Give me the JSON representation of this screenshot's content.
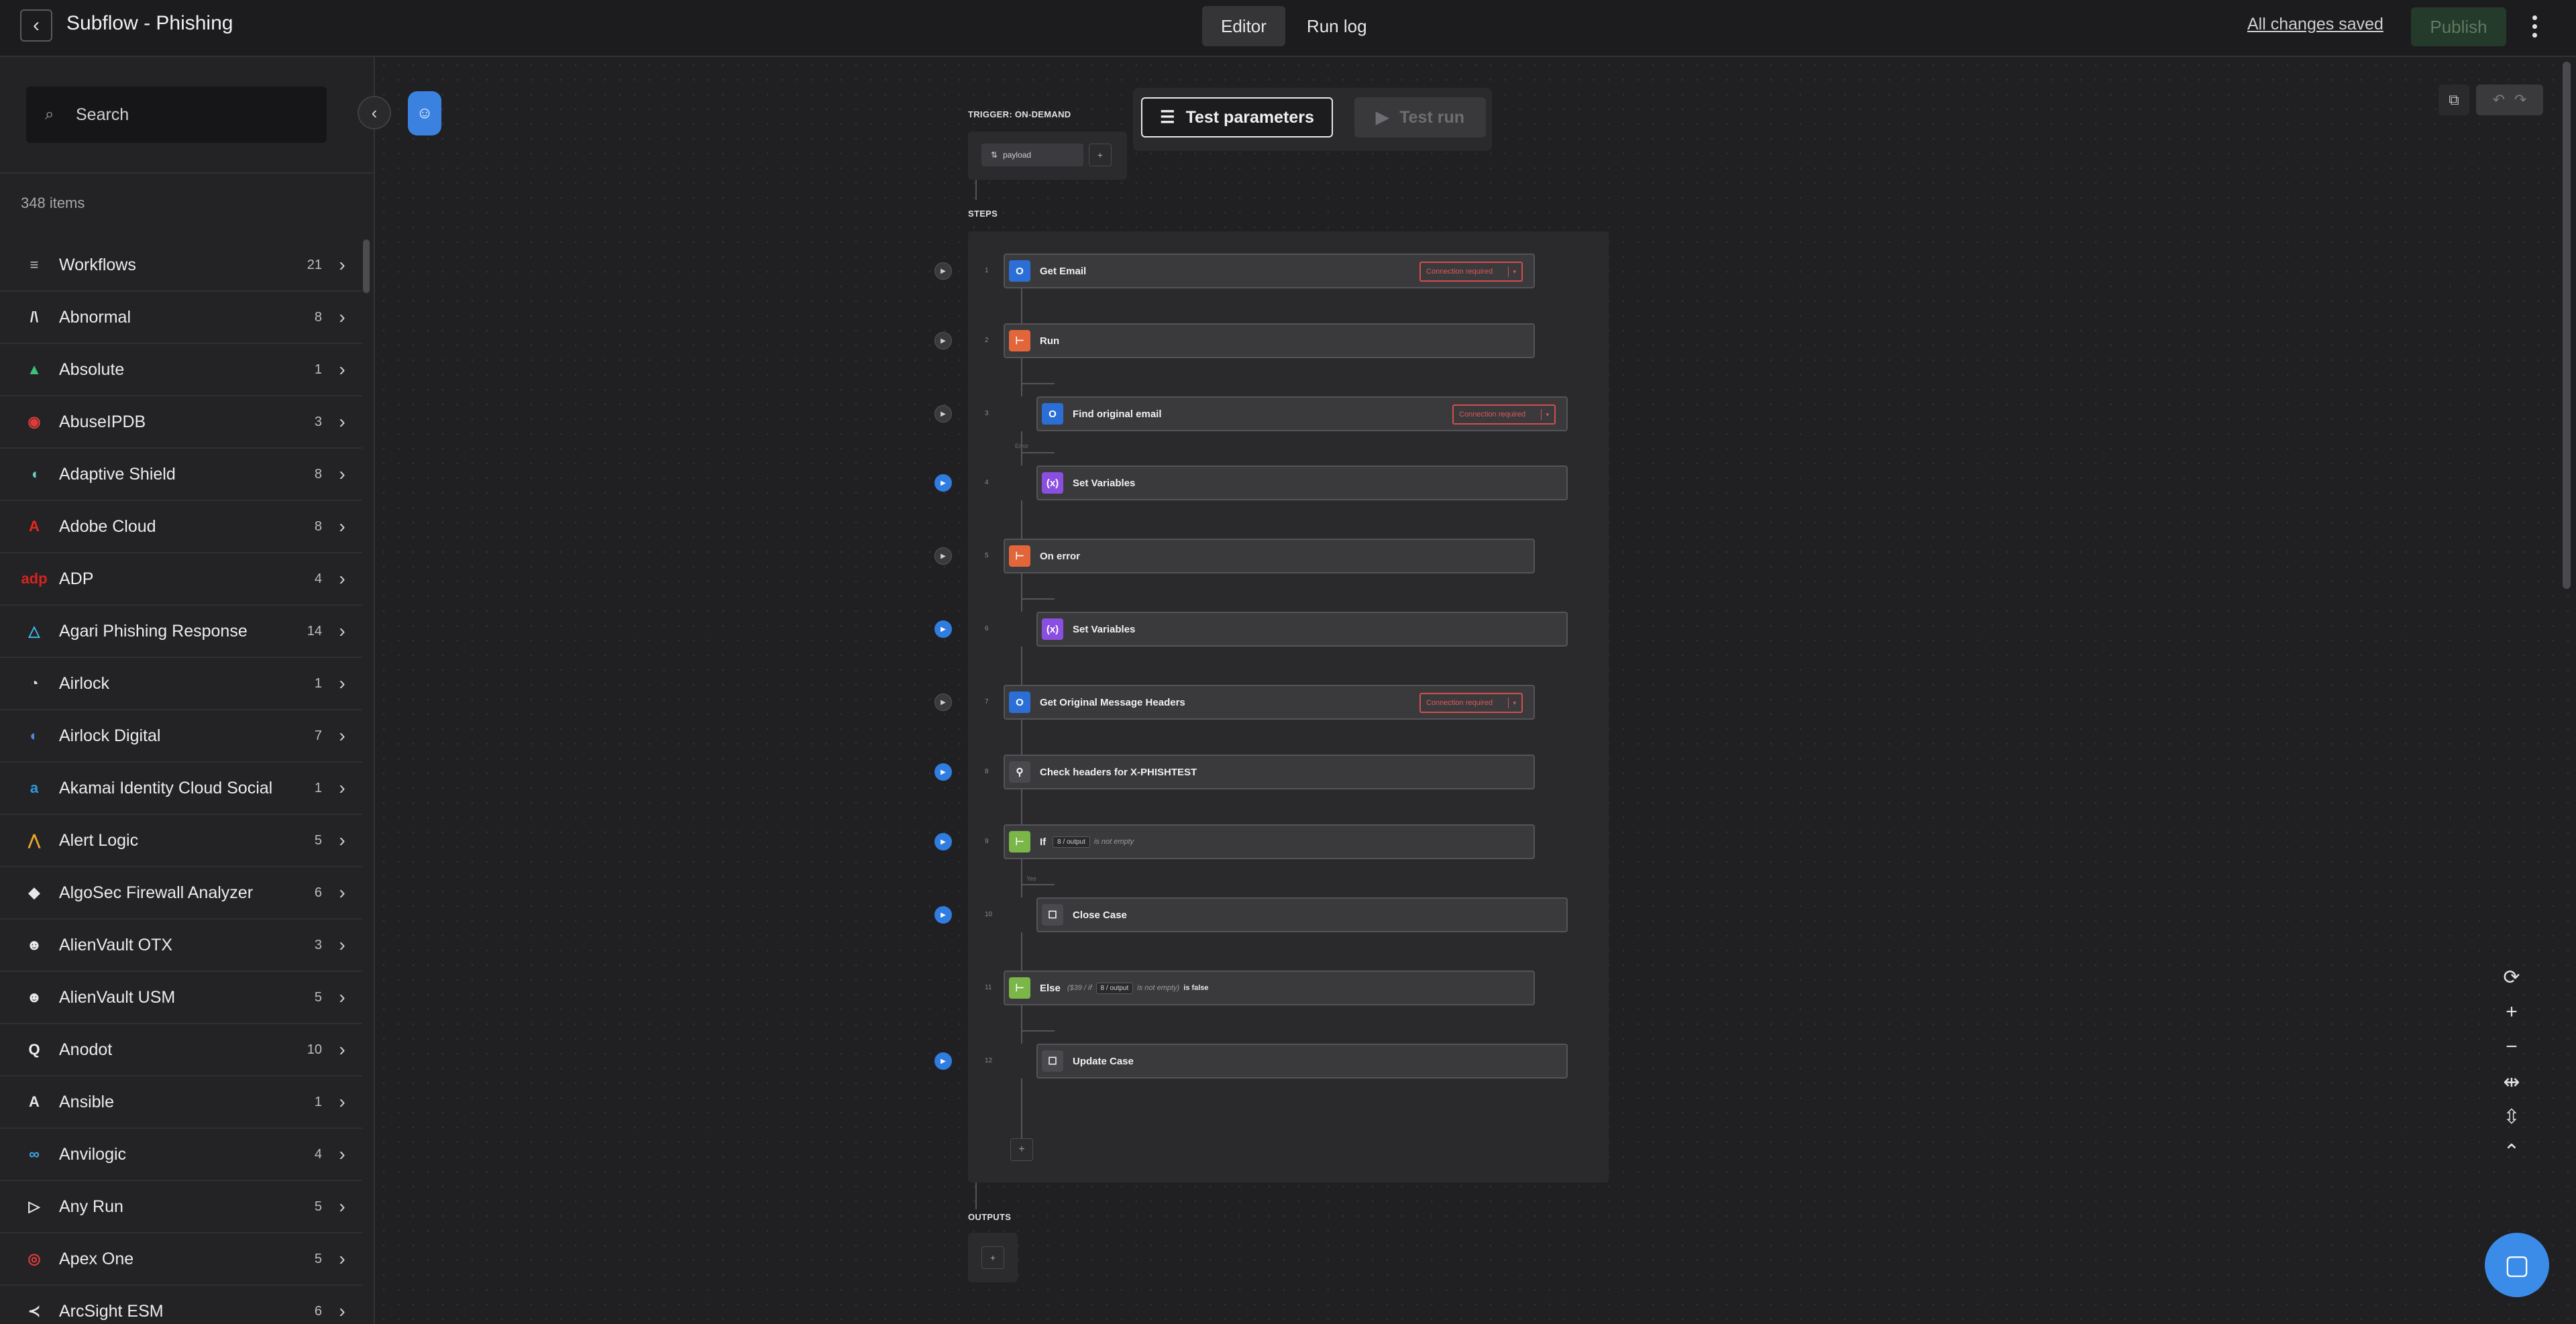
{
  "header": {
    "title": "Subflow - Phishing",
    "tabs": [
      {
        "label": "Editor"
      },
      {
        "label": "Run log"
      }
    ],
    "saved_status": "All changes saved",
    "publish_label": "Publish"
  },
  "sidebar": {
    "search_placeholder": "Search",
    "count_label": "348 items",
    "items": [
      {
        "name": "Workflows",
        "count": "21",
        "logo": "≡",
        "color": "#bdbdbd"
      },
      {
        "name": "Abnormal",
        "count": "8",
        "logo": "/\\",
        "color": "#e8e8e8"
      },
      {
        "name": "Absolute",
        "count": "1",
        "logo": "▲",
        "color": "#3cc474"
      },
      {
        "name": "AbuseIPDB",
        "count": "3",
        "logo": "◉",
        "color": "#e03b3b"
      },
      {
        "name": "Adaptive Shield",
        "count": "8",
        "logo": "◖",
        "color": "#6ad0c8"
      },
      {
        "name": "Adobe Cloud",
        "count": "8",
        "logo": "A",
        "color": "#e8271c"
      },
      {
        "name": "ADP",
        "count": "4",
        "logo": "adp",
        "color": "#d8231e"
      },
      {
        "name": "Agari Phishing Response",
        "count": "14",
        "logo": "△",
        "color": "#3fb6e6"
      },
      {
        "name": "Airlock",
        "count": "1",
        "logo": "◔",
        "color": "#e0e0e0"
      },
      {
        "name": "Airlock Digital",
        "count": "7",
        "logo": "◐",
        "color": "#4a8be0"
      },
      {
        "name": "Akamai Identity Cloud Social",
        "count": "1",
        "logo": "a",
        "color": "#2d9be0"
      },
      {
        "name": "Alert Logic",
        "count": "5",
        "logo": "⋀",
        "color": "#e8a62a"
      },
      {
        "name": "AlgoSec Firewall Analyzer",
        "count": "6",
        "logo": "◆",
        "color": "#e8e8e8"
      },
      {
        "name": "AlienVault OTX",
        "count": "3",
        "logo": "☻",
        "color": "#e8e8e8"
      },
      {
        "name": "AlienVault USM",
        "count": "5",
        "logo": "☻",
        "color": "#e8e8e8"
      },
      {
        "name": "Anodot",
        "count": "10",
        "logo": "Q",
        "color": "#f0f0f0"
      },
      {
        "name": "Ansible",
        "count": "1",
        "logo": "A",
        "color": "#e8e8e8"
      },
      {
        "name": "Anvilogic",
        "count": "4",
        "logo": "∞",
        "color": "#3fa8e6"
      },
      {
        "name": "Any Run",
        "count": "5",
        "logo": "▷",
        "color": "#e8e8e8"
      },
      {
        "name": "Apex One",
        "count": "5",
        "logo": "◎",
        "color": "#e03b3b"
      },
      {
        "name": "ArcSight ESM",
        "count": "6",
        "logo": "≺",
        "color": "#e8e8e8"
      }
    ]
  },
  "canvas": {
    "trigger_label": "TRIGGER: ON-DEMAND",
    "payload_label": "payload",
    "test_params_label": "Test parameters",
    "test_run_label": "Test run",
    "steps_label": "STEPS",
    "outputs_label": "OUTPUTS",
    "connection_required": "Connection required",
    "fail_label": "Error",
    "yes_label": "Yes",
    "steps": [
      {
        "num": "1",
        "title": "Get Email",
        "icon": "O",
        "icon_color": "#2b6fd6",
        "indent": 0,
        "conn": true,
        "play": "grey",
        "extra": ""
      },
      {
        "num": "2",
        "title": "Run",
        "icon": "⊢",
        "icon_color": "#e2663a",
        "indent": 0,
        "conn": false,
        "play": "grey",
        "extra": ""
      },
      {
        "num": "3",
        "title": "Find original email",
        "icon": "O",
        "icon_color": "#2b6fd6",
        "indent": 1,
        "conn": true,
        "play": "grey",
        "extra": ""
      },
      {
        "num": "4",
        "title": "Set Variables",
        "icon": "(x)",
        "icon_color": "#8a4fe0",
        "indent": 1,
        "conn": false,
        "play": "blue",
        "extra": ""
      },
      {
        "num": "5",
        "title": "On error",
        "icon": "⊢",
        "icon_color": "#e2663a",
        "indent": 0,
        "conn": false,
        "play": "grey",
        "extra": ""
      },
      {
        "num": "6",
        "title": "Set Variables",
        "icon": "(x)",
        "icon_color": "#8a4fe0",
        "indent": 1,
        "conn": false,
        "play": "blue",
        "extra": ""
      },
      {
        "num": "7",
        "title": "Get Original Message Headers",
        "icon": "O",
        "icon_color": "#2b6fd6",
        "indent": 0,
        "conn": true,
        "play": "grey",
        "extra": ""
      },
      {
        "num": "8",
        "title": "Check headers for X-PHISHTEST",
        "icon": "⚲",
        "icon_color": "#4a4a4e",
        "indent": 0,
        "conn": false,
        "play": "blue",
        "extra": ""
      },
      {
        "num": "9",
        "title": "If",
        "icon": "⊢",
        "icon_color": "#7ab648",
        "indent": 0,
        "conn": false,
        "play": "blue",
        "extra": "is not empty",
        "chip": "8 / output"
      },
      {
        "num": "10",
        "title": "Close Case",
        "icon": "☐",
        "icon_color": "#4a4a4e",
        "indent": 1,
        "conn": false,
        "play": "blue",
        "extra": ""
      },
      {
        "num": "11",
        "title": "Else",
        "icon": "⊢",
        "icon_color": "#7ab648",
        "indent": 0,
        "conn": false,
        "play": "none",
        "extra_pre": "($39 / if",
        "chip": "8 / output",
        "extra": "is not empty)",
        "extra_post": "is false"
      },
      {
        "num": "12",
        "title": "Update Case",
        "icon": "☐",
        "icon_color": "#4a4a4e",
        "indent": 1,
        "conn": false,
        "play": "blue",
        "extra": ""
      }
    ]
  }
}
